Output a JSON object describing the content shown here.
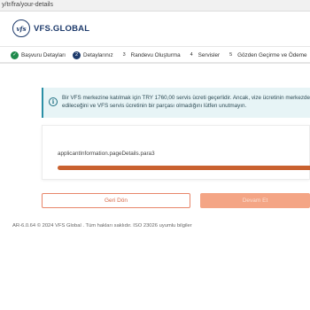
{
  "browser": {
    "url": "y/tr/fra/your-details"
  },
  "header": {
    "logo_mark": "vfs",
    "logo_text": "VFS.GLOBAL"
  },
  "stepper": {
    "steps": [
      {
        "number": "✓",
        "label": "Başvuru Detayları",
        "state": "done"
      },
      {
        "number": "2",
        "label": "Detaylarınız",
        "state": "active"
      },
      {
        "number": "3",
        "label": "Randevu Oluşturma",
        "state": "todo"
      },
      {
        "number": "4",
        "label": "Servisler",
        "state": "todo"
      },
      {
        "number": "5",
        "label": "Gözden Geçirme ve Ödeme",
        "state": "todo"
      }
    ]
  },
  "info": {
    "icon": "info-icon",
    "line1": "Bir VFS merkezine katılmak için TRY 1760,00 servis ücreti geçerlidir. Ancak, vize ücretinin merkezde t",
    "line2": "edileceğini ve VFS servis ücretinin bir parçası olmadığını lütfen unutmayın."
  },
  "card": {
    "text": "applicantInformation.pageDetails.para3"
  },
  "buttons": {
    "back": "Geri Dön",
    "next": "Devam Et"
  },
  "footer": {
    "text": "AR-6.0.64 © 2024 VFS Global . Tüm hakları saklıdır. ISO 23026 uyumlu bilgiler"
  },
  "colors": {
    "brand_navy": "#1d3a6b",
    "accent_orange": "#c9612f",
    "success_green": "#1f8a4c",
    "info_bg": "#e7f4f6"
  }
}
